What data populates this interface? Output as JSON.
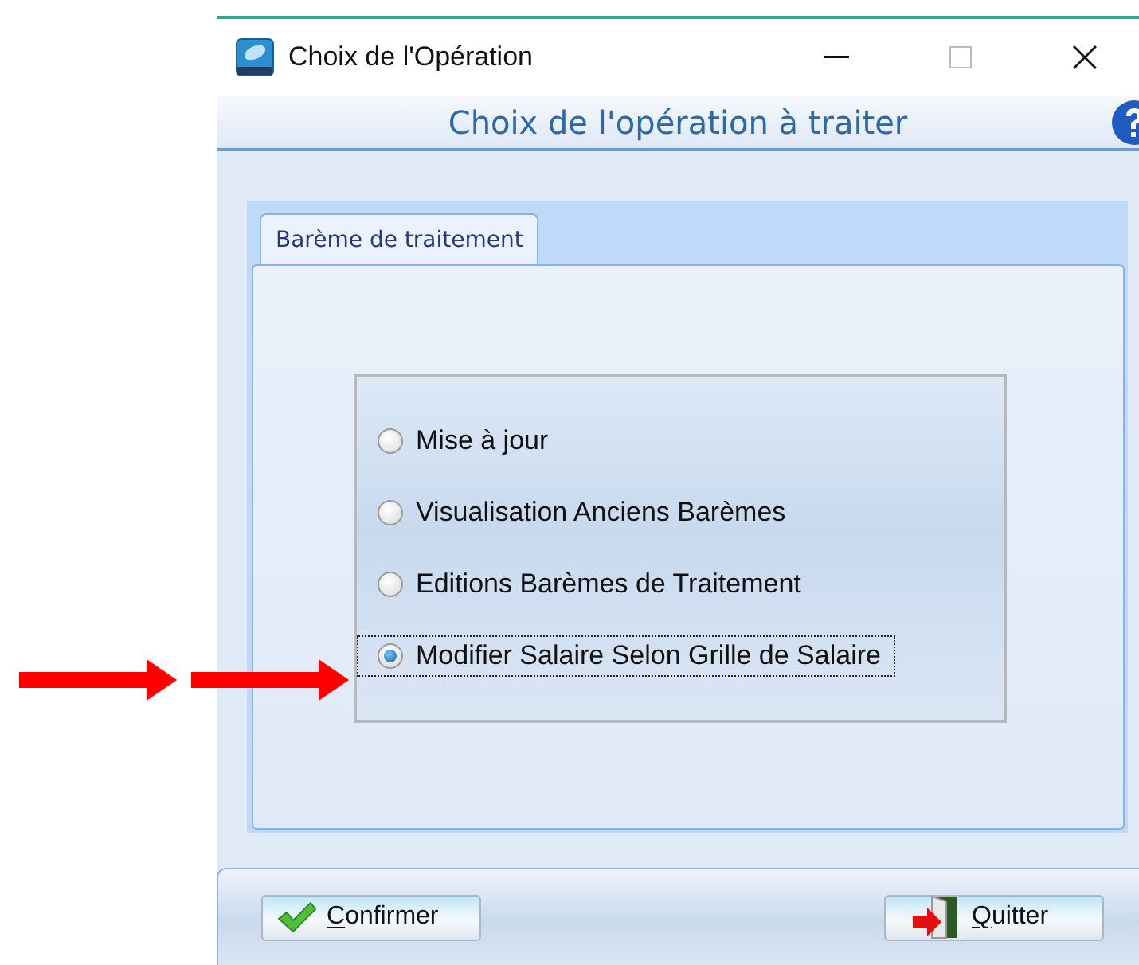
{
  "window": {
    "title": "Choix de l'Opération"
  },
  "header": {
    "title": "Choix de l'opération à traiter"
  },
  "tabs": [
    {
      "label": "Barème de traitement",
      "selected": true
    }
  ],
  "options": [
    {
      "label": "Mise à jour",
      "selected": false,
      "focused": false
    },
    {
      "label": "Visualisation Anciens Barèmes",
      "selected": false,
      "focused": false
    },
    {
      "label": "Editions Barèmes de Traitement",
      "selected": false,
      "focused": false
    },
    {
      "label": "Modifier Salaire Selon Grille de Salaire",
      "selected": true,
      "focused": true
    }
  ],
  "buttons": [
    {
      "kind": "confirm",
      "label": "Confirmer",
      "mnemonic_underlined": true
    },
    {
      "kind": "quit",
      "label": "Quitter",
      "mnemonic_underlined": true
    }
  ],
  "annotations": [
    {
      "kind": "arrow"
    },
    {
      "kind": "arrow"
    }
  ]
}
